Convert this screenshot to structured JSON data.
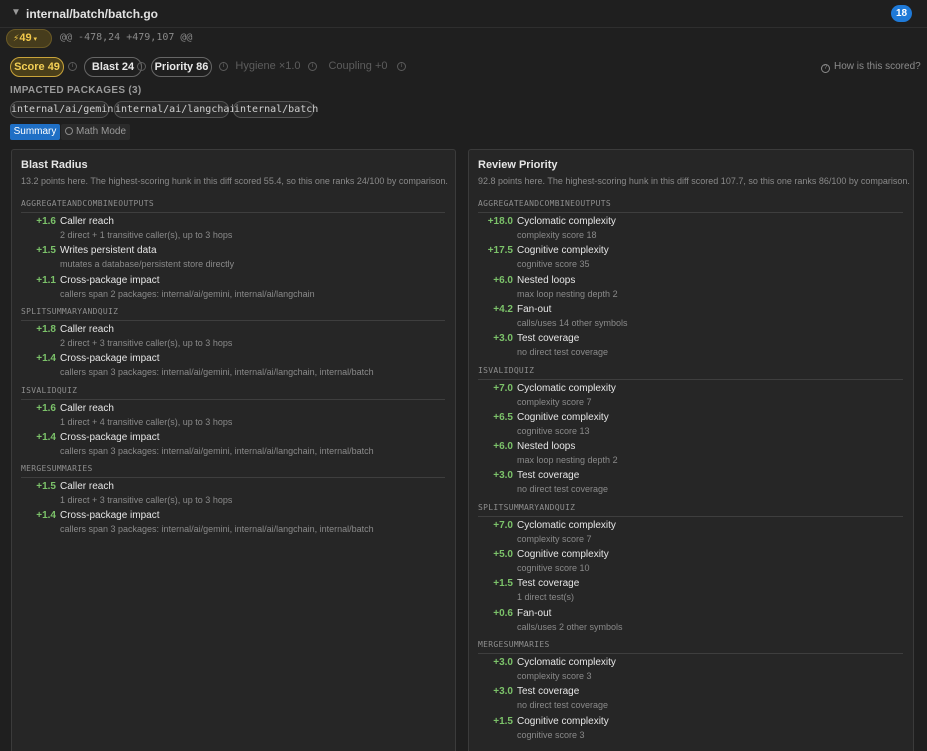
{
  "header": {
    "file_path": "internal/batch/batch.go",
    "count": "18",
    "score_pill": "49",
    "hunk_range": "@@ -478,24 +479,107 @@"
  },
  "metrics": {
    "score": "Score 49",
    "blast": "Blast 24",
    "priority": "Priority 86",
    "hygiene": "Hygiene ×1.0",
    "coupling": "Coupling +0",
    "how_scored": "How is this scored?"
  },
  "impacted": {
    "title": "IMPACTED PACKAGES (3)",
    "packages": [
      "internal/ai/gemini",
      "internal/ai/langchain",
      "internal/batch"
    ]
  },
  "tabs": {
    "summary": "Summary",
    "math": "Math Mode"
  },
  "blast_radius": {
    "title": "Blast Radius",
    "desc": "13.2 points here. The highest-scoring hunk in this diff scored 55.4, so this one ranks 24/100 by comparison.",
    "groups": [
      {
        "name": "AGGREGATEANDCOMBINEOUTPUTS",
        "items": [
          {
            "delta": "+1.6",
            "title": "Caller reach",
            "sub": "2 direct + 1 transitive caller(s), up to 3 hops"
          },
          {
            "delta": "+1.5",
            "title": "Writes persistent data",
            "sub": "mutates a database/persistent store directly"
          },
          {
            "delta": "+1.1",
            "title": "Cross-package impact",
            "sub": "callers span 2 packages: internal/ai/gemini, internal/ai/langchain"
          }
        ]
      },
      {
        "name": "SPLITSUMMARYANDQUIZ",
        "items": [
          {
            "delta": "+1.8",
            "title": "Caller reach",
            "sub": "2 direct + 3 transitive caller(s), up to 3 hops"
          },
          {
            "delta": "+1.4",
            "title": "Cross-package impact",
            "sub": "callers span 3 packages: internal/ai/gemini, internal/ai/langchain, internal/batch"
          }
        ]
      },
      {
        "name": "ISVALIDQUIZ",
        "items": [
          {
            "delta": "+1.6",
            "title": "Caller reach",
            "sub": "1 direct + 4 transitive caller(s), up to 3 hops"
          },
          {
            "delta": "+1.4",
            "title": "Cross-package impact",
            "sub": "callers span 3 packages: internal/ai/gemini, internal/ai/langchain, internal/batch"
          }
        ]
      },
      {
        "name": "MERGESUMMARIES",
        "items": [
          {
            "delta": "+1.5",
            "title": "Caller reach",
            "sub": "1 direct + 3 transitive caller(s), up to 3 hops"
          },
          {
            "delta": "+1.4",
            "title": "Cross-package impact",
            "sub": "callers span 3 packages: internal/ai/gemini, internal/ai/langchain, internal/batch"
          }
        ]
      }
    ]
  },
  "review_priority": {
    "title": "Review Priority",
    "desc": "92.8 points here. The highest-scoring hunk in this diff scored 107.7, so this one ranks 86/100 by comparison.",
    "groups": [
      {
        "name": "AGGREGATEANDCOMBINEOUTPUTS",
        "items": [
          {
            "delta": "+18.0",
            "title": "Cyclomatic complexity",
            "sub": "complexity score 18"
          },
          {
            "delta": "+17.5",
            "title": "Cognitive complexity",
            "sub": "cognitive score 35"
          },
          {
            "delta": "+6.0",
            "title": "Nested loops",
            "sub": "max loop nesting depth 2"
          },
          {
            "delta": "+4.2",
            "title": "Fan-out",
            "sub": "calls/uses 14 other symbols"
          },
          {
            "delta": "+3.0",
            "title": "Test coverage",
            "sub": "no direct test coverage"
          }
        ]
      },
      {
        "name": "ISVALIDQUIZ",
        "items": [
          {
            "delta": "+7.0",
            "title": "Cyclomatic complexity",
            "sub": "complexity score 7"
          },
          {
            "delta": "+6.5",
            "title": "Cognitive complexity",
            "sub": "cognitive score 13"
          },
          {
            "delta": "+6.0",
            "title": "Nested loops",
            "sub": "max loop nesting depth 2"
          },
          {
            "delta": "+3.0",
            "title": "Test coverage",
            "sub": "no direct test coverage"
          }
        ]
      },
      {
        "name": "SPLITSUMMARYANDQUIZ",
        "items": [
          {
            "delta": "+7.0",
            "title": "Cyclomatic complexity",
            "sub": "complexity score 7"
          },
          {
            "delta": "+5.0",
            "title": "Cognitive complexity",
            "sub": "cognitive score 10"
          },
          {
            "delta": "+1.5",
            "title": "Test coverage",
            "sub": "1 direct test(s)"
          },
          {
            "delta": "+0.6",
            "title": "Fan-out",
            "sub": "calls/uses 2 other symbols"
          }
        ]
      },
      {
        "name": "MERGESUMMARIES",
        "items": [
          {
            "delta": "+3.0",
            "title": "Cyclomatic complexity",
            "sub": "complexity score 3"
          },
          {
            "delta": "+3.0",
            "title": "Test coverage",
            "sub": "no direct test coverage"
          },
          {
            "delta": "+1.5",
            "title": "Cognitive complexity",
            "sub": "cognitive score 3"
          }
        ]
      }
    ]
  }
}
